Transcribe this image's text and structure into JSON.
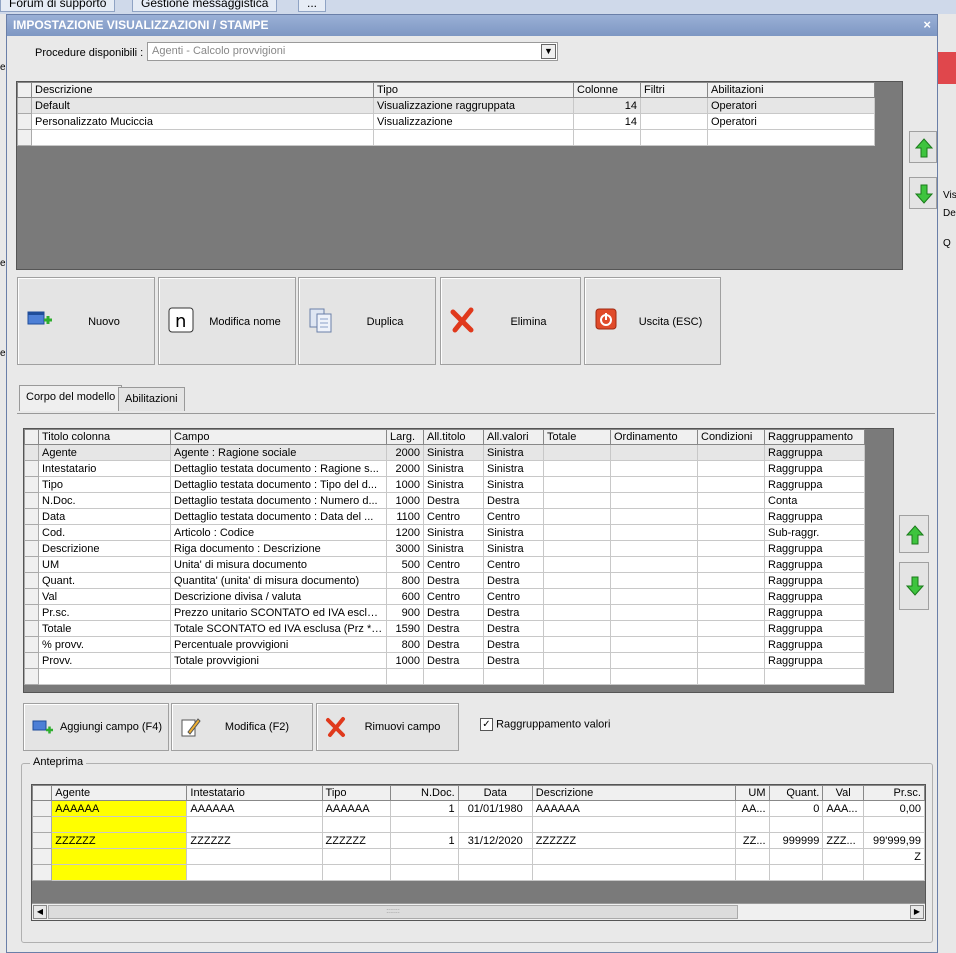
{
  "browser_tabs": [
    "Forum di supporto",
    "Gestione messaggistica",
    "..."
  ],
  "background": {
    "right_labels": [
      "Vis",
      "De",
      "Q"
    ],
    "left_labels": [
      "er",
      "e",
      "e"
    ]
  },
  "dialog": {
    "title": "IMPOSTAZIONE VISUALIZZAZIONI / STAMPE",
    "close": "×",
    "procedure_label": "Procedure disponibili :",
    "procedure_value": "Agenti - Calcolo provvigioni",
    "models_table": {
      "headers": [
        "Descrizione",
        "Tipo",
        "Colonne",
        "Filtri",
        "Abilitazioni"
      ],
      "rows": [
        [
          "Default",
          "Visualizzazione raggruppata",
          "14",
          "",
          "Operatori"
        ],
        [
          "Personalizzato Muciccia",
          "Visualizzazione",
          "14",
          "",
          "Operatori"
        ]
      ]
    },
    "buttons": {
      "nuovo": "Nuovo",
      "modifica_nome": "Modifica nome",
      "duplica": "Duplica",
      "elimina": "Elimina",
      "uscita": "Uscita (ESC)"
    },
    "tabs": [
      "Corpo del modello",
      "Abilitazioni"
    ],
    "columns_table": {
      "headers": [
        "Titolo colonna",
        "Campo",
        "Larg.",
        "All.titolo",
        "All.valori",
        "Totale",
        "Ordinamento",
        "Condizioni",
        "Raggruppamento"
      ],
      "rows": [
        [
          "Agente",
          "Agente : Ragione sociale",
          "2000",
          "Sinistra",
          "Sinistra",
          "",
          "",
          "",
          "Raggruppa"
        ],
        [
          "Intestatario",
          "Dettaglio testata documento : Ragione s...",
          "2000",
          "Sinistra",
          "Sinistra",
          "",
          "",
          "",
          "Raggruppa"
        ],
        [
          "Tipo",
          "Dettaglio testata documento : Tipo del d...",
          "1000",
          "Sinistra",
          "Sinistra",
          "",
          "",
          "",
          "Raggruppa"
        ],
        [
          "N.Doc.",
          "Dettaglio testata documento : Numero d...",
          "1000",
          "Destra",
          "Destra",
          "",
          "",
          "",
          "Conta"
        ],
        [
          "Data",
          "Dettaglio testata documento : Data del ...",
          "1100",
          "Centro",
          "Centro",
          "",
          "",
          "",
          "Raggruppa"
        ],
        [
          "Cod.",
          "Articolo : Codice",
          "1200",
          "Sinistra",
          "Sinistra",
          "",
          "",
          "",
          "Sub-raggr."
        ],
        [
          "Descrizione",
          "Riga documento : Descrizione",
          "3000",
          "Sinistra",
          "Sinistra",
          "",
          "",
          "",
          "Raggruppa"
        ],
        [
          "UM",
          "Unita' di misura documento",
          "500",
          "Centro",
          "Centro",
          "",
          "",
          "",
          "Raggruppa"
        ],
        [
          "Quant.",
          "Quantita' (unita' di misura documento)",
          "800",
          "Destra",
          "Destra",
          "",
          "",
          "",
          "Raggruppa"
        ],
        [
          "Val",
          "Descrizione divisa / valuta",
          "600",
          "Centro",
          "Centro",
          "",
          "",
          "",
          "Raggruppa"
        ],
        [
          "Pr.sc.",
          "Prezzo unitario SCONTATO ed IVA esclusa",
          "900",
          "Destra",
          "Destra",
          "",
          "",
          "",
          "Raggruppa"
        ],
        [
          "Totale",
          "Totale SCONTATO ed IVA esclusa (Prz * ...",
          "1590",
          "Destra",
          "Destra",
          "",
          "",
          "",
          "Raggruppa"
        ],
        [
          "% provv.",
          "Percentuale provvigioni",
          "800",
          "Destra",
          "Destra",
          "",
          "",
          "",
          "Raggruppa"
        ],
        [
          "Provv.",
          "Totale provvigioni",
          "1000",
          "Destra",
          "Destra",
          "",
          "",
          "",
          "Raggruppa"
        ]
      ]
    },
    "field_buttons": {
      "aggiungi": "Aggiungi campo (F4)",
      "modifica": "Modifica (F2)",
      "rimuovi": "Rimuovi campo"
    },
    "raggruppamento_label": "Raggruppamento valori",
    "raggruppamento_checked": "✓",
    "preview": {
      "legend": "Anteprima",
      "headers": [
        "Agente",
        "Intestatario",
        "Tipo",
        "N.Doc.",
        "Data",
        "Descrizione",
        "UM",
        "Quant.",
        "Val",
        "Pr.sc."
      ],
      "rows": [
        [
          "AAAAAA",
          "AAAAAA",
          "AAAAAA",
          "1",
          "01/01/1980",
          "AAAAAA",
          "AA...",
          "0",
          "AAA...",
          "0,00"
        ],
        [
          "",
          "",
          "",
          "",
          "",
          "",
          "",
          "",
          "",
          ""
        ],
        [
          "ZZZZZZ",
          "ZZZZZZ",
          "ZZZZZZ",
          "1",
          "31/12/2020",
          "ZZZZZZ",
          "ZZ...",
          "999999",
          "ZZZ...",
          "99'999,99"
        ],
        [
          "",
          "",
          "",
          "",
          "",
          "",
          "",
          "",
          "",
          "Z"
        ],
        [
          "",
          "",
          "",
          "",
          "",
          "",
          "",
          "",
          "",
          ""
        ]
      ]
    }
  }
}
